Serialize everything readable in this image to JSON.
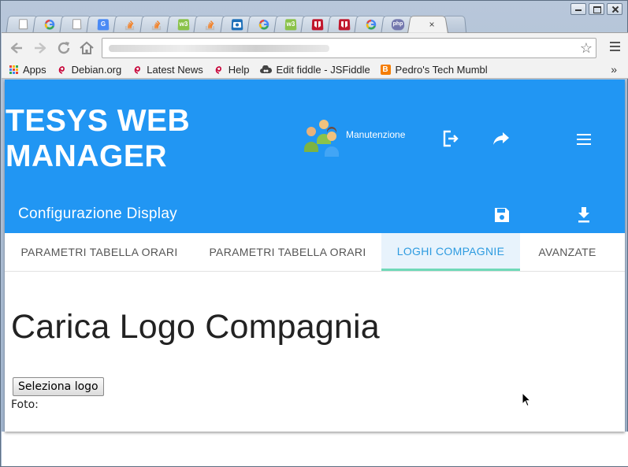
{
  "browser": {
    "tabs": [
      {
        "icon": "page-icon",
        "color": "#ffffff"
      },
      {
        "icon": "google-icon",
        "color": "#4285f4"
      },
      {
        "icon": "page-icon",
        "color": "#ffffff"
      },
      {
        "icon": "google-translate-icon",
        "color": "#4a8af4"
      },
      {
        "icon": "stackoverflow-icon",
        "color": "#f48024"
      },
      {
        "icon": "stackoverflow-icon",
        "color": "#f48024"
      },
      {
        "icon": "w3schools-icon",
        "color": "#8ac249"
      },
      {
        "icon": "stackoverflow-icon",
        "color": "#f48024"
      },
      {
        "icon": "camera-icon",
        "color": "#1d6fb8"
      },
      {
        "icon": "google-icon",
        "color": "#4285f4"
      },
      {
        "icon": "w3schools-icon",
        "color": "#8ac249"
      },
      {
        "icon": "bookmark-red-icon",
        "color": "#c0162c"
      },
      {
        "icon": "bookmark-red-icon",
        "color": "#c0162c"
      },
      {
        "icon": "google-icon",
        "color": "#4285f4"
      },
      {
        "icon": "php-icon",
        "color": "#7377ad"
      }
    ],
    "w3_label": "w3",
    "php_label": "php",
    "active_tab_close": "×",
    "address": "",
    "bookmarks": [
      {
        "label": "Apps",
        "icon": "apps-grid-icon"
      },
      {
        "label": "Debian.org",
        "icon": "debian-icon"
      },
      {
        "label": "Latest News",
        "icon": "debian-icon"
      },
      {
        "label": "Help",
        "icon": "debian-icon"
      },
      {
        "label": "Edit fiddle - JSFiddle",
        "icon": "jsfiddle-icon"
      },
      {
        "label": "Pedro's Tech Mumbl",
        "icon": "blogger-icon"
      }
    ],
    "bookmarks_overflow": "»"
  },
  "app": {
    "title_line1": "TESYS WEB",
    "title_line2": "MANAGER",
    "user_label": "Manutenzione",
    "subtitle": "Configurazione Display",
    "tabs": [
      {
        "label": "PARAMETRI TABELLA ORARI",
        "active": false
      },
      {
        "label": "PARAMETRI TABELLA ORARI",
        "active": false
      },
      {
        "label": "LOGHI COMPAGNIE",
        "active": true
      },
      {
        "label": "AVANZATE",
        "active": false
      }
    ],
    "content_title": "Carica Logo Compagnia",
    "upload_button": "Seleziona logo",
    "foto_label": "Foto:",
    "colors": {
      "header": "#2196f3",
      "active_tab_text": "#2d9be0",
      "active_tab_indicator": "#6fd9b8"
    }
  }
}
